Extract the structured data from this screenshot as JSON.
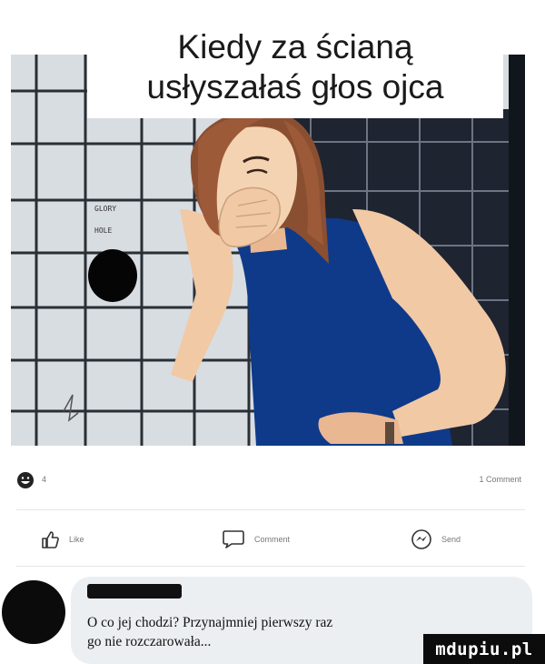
{
  "meme": {
    "caption_lines": [
      "Kiedy za ścianą",
      "usłyszałaś głos ojca"
    ],
    "wall_sign": [
      "GLORY",
      "HOLE"
    ]
  },
  "post": {
    "reaction_count": "4",
    "comment_count": "1 Comment",
    "actions": {
      "like": "Like",
      "comment": "Comment",
      "send": "Send"
    }
  },
  "comment": {
    "text_lines": [
      "O co jej chodzi? Przynajmniej pierwszy raz",
      "go nie rozczarowała..."
    ]
  },
  "watermark": "mdupiu.pl",
  "colors": {
    "tile": "#d8dde2",
    "grout": "#2a2f36",
    "tank_top": "#0f3a8a",
    "skin": "#f1c9a5",
    "hair": "#8a4f31",
    "bubble": "#eceff2"
  }
}
